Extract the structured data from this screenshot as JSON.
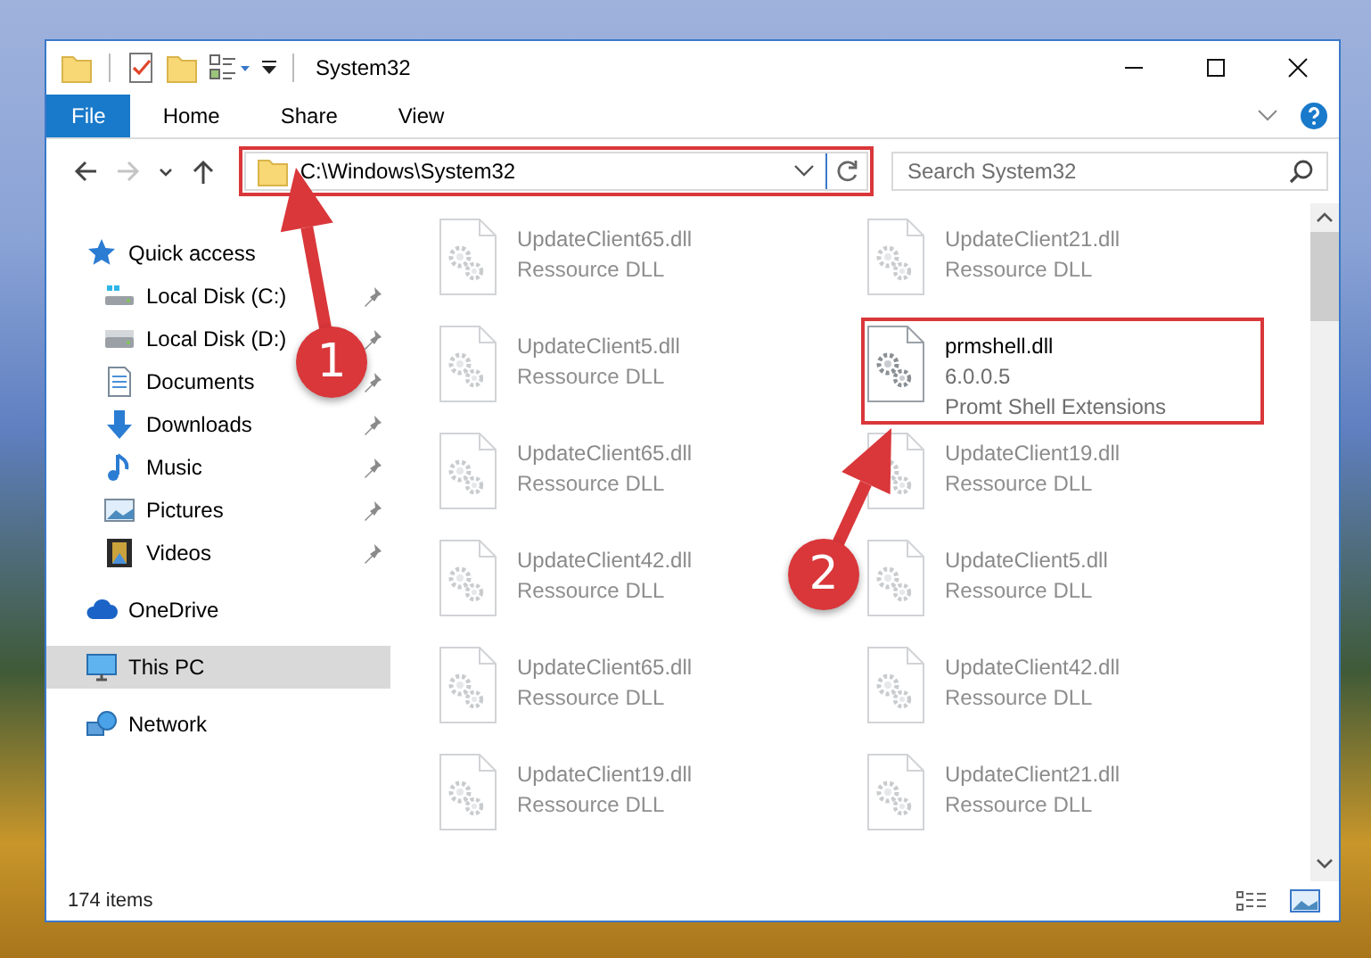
{
  "window": {
    "title": "System32"
  },
  "ribbon": {
    "tabs": [
      {
        "label": "File",
        "kind": "file_menu",
        "selected": false
      },
      {
        "label": "Home",
        "kind": "tab",
        "selected": false
      },
      {
        "label": "Share",
        "kind": "tab",
        "selected": false
      },
      {
        "label": "View",
        "kind": "tab",
        "selected": false
      }
    ]
  },
  "nav_buttons": [
    {
      "kind": "back",
      "disabled": false
    },
    {
      "kind": "forward",
      "disabled": true
    },
    {
      "kind": "recent",
      "disabled": false
    },
    {
      "kind": "up",
      "disabled": false
    }
  ],
  "address_bar": {
    "path": "C:\\Windows\\System32"
  },
  "search": {
    "placeholder": "Search System32"
  },
  "sidebar": {
    "items": [
      {
        "label": "Quick access",
        "selected": false,
        "children": [
          {
            "label": "Local Disk (C:)",
            "pinned": true,
            "selected": false
          },
          {
            "label": "Local Disk (D:)",
            "pinned": true,
            "selected": false
          },
          {
            "label": "Documents",
            "pinned": true,
            "selected": false
          },
          {
            "label": "Downloads",
            "pinned": true,
            "selected": false
          },
          {
            "label": "Music",
            "pinned": true,
            "selected": false
          },
          {
            "label": "Pictures",
            "pinned": true,
            "selected": false
          },
          {
            "label": "Videos",
            "pinned": true,
            "selected": false
          }
        ]
      },
      {
        "label": "OneDrive",
        "selected": false
      },
      {
        "label": "This PC",
        "selected": true
      },
      {
        "label": "Network",
        "selected": false
      }
    ]
  },
  "files": [
    {
      "name": "UpdateClient65.dll",
      "lines": [
        "Ressource DLL"
      ],
      "blurred": true
    },
    {
      "name": "UpdateClient21.dll",
      "lines": [
        "Ressource DLL"
      ],
      "blurred": true
    },
    {
      "name": "UpdateClient5.dll",
      "lines": [
        "Ressource DLL"
      ],
      "blurred": true
    },
    {
      "name": "prmshell.dll",
      "lines": [
        "6.0.0.5",
        "Promt Shell Extensions"
      ],
      "blurred": false
    },
    {
      "name": "UpdateClient65.dll",
      "lines": [
        "Ressource DLL"
      ],
      "blurred": true
    },
    {
      "name": "UpdateClient19.dll",
      "lines": [
        "Ressource DLL"
      ],
      "blurred": true
    },
    {
      "name": "UpdateClient42.dll",
      "lines": [
        "Ressource DLL"
      ],
      "blurred": true
    },
    {
      "name": "UpdateClient5.dll",
      "lines": [
        "Ressource DLL"
      ],
      "blurred": true
    },
    {
      "name": "UpdateClient65.dll",
      "lines": [
        "Ressource DLL"
      ],
      "blurred": true
    },
    {
      "name": "UpdateClient42.dll",
      "lines": [
        "Ressource DLL"
      ],
      "blurred": true
    },
    {
      "name": "UpdateClient19.dll",
      "lines": [
        "Ressource DLL"
      ],
      "blurred": true
    },
    {
      "name": "UpdateClient21.dll",
      "lines": [
        "Ressource DLL"
      ],
      "blurred": true
    }
  ],
  "status_bar": {
    "item_count": "174 items"
  },
  "annotations": {
    "callouts": [
      {
        "number": "1"
      },
      {
        "number": "2"
      }
    ]
  }
}
